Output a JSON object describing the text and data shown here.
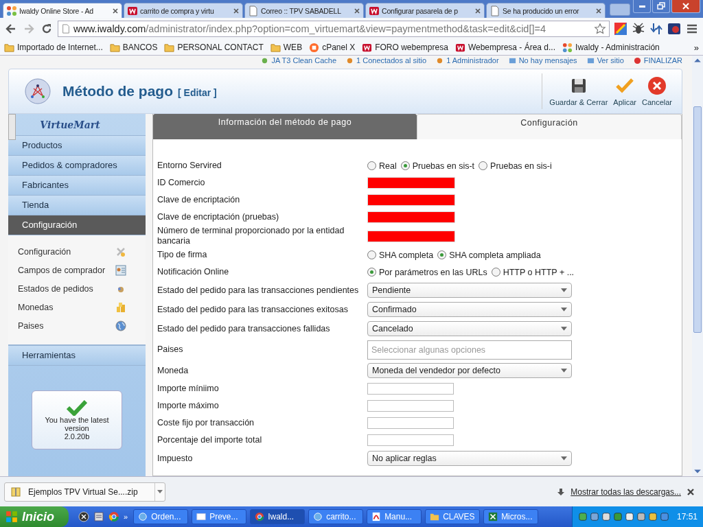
{
  "browser_tabs": [
    {
      "title": "Iwaldy Online Store - Ad",
      "kind": "joomla",
      "selected": true
    },
    {
      "title": "carrito de compra y virtu",
      "kind": "webempresa",
      "selected": false
    },
    {
      "title": "Correo :: TPV SABADELL",
      "kind": "page",
      "selected": false
    },
    {
      "title": "Configurar pasarela de p",
      "kind": "webempresa",
      "selected": false
    },
    {
      "title": "Se ha producido un error",
      "kind": "page",
      "selected": false
    }
  ],
  "address": {
    "host": "www.iwaldy.com",
    "path": "/administrator/index.php?option=com_virtuemart&view=paymentmethod&task=edit&cid[]=4"
  },
  "bookmarks": [
    {
      "label": "Importado de Internet...",
      "kind": "folder"
    },
    {
      "label": "BANCOS",
      "kind": "folder"
    },
    {
      "label": "PERSONAL CONTACT",
      "kind": "folder"
    },
    {
      "label": "WEB",
      "kind": "folder"
    },
    {
      "label": "cPanel X",
      "kind": "cpanel"
    },
    {
      "label": "FORO webempresa",
      "kind": "webempresa"
    },
    {
      "label": "Webempresa - Área d...",
      "kind": "webempresa"
    },
    {
      "label": "Iwaldy - Administración",
      "kind": "joomla"
    }
  ],
  "bookmarks_more": "»",
  "admin_links": [
    {
      "label": "JA T3 Clean Cache",
      "kind": "cache"
    },
    {
      "label": "1 Conectados al sitio",
      "kind": "users"
    },
    {
      "label": "1 Administrador",
      "kind": "users"
    },
    {
      "label": "No hay mensajes",
      "kind": "mail"
    },
    {
      "label": "Ver sitio",
      "kind": "screen"
    },
    {
      "label": "FINALIZAR",
      "kind": "logout"
    }
  ],
  "header": {
    "title": "Método de pago",
    "subtitle": "[ Editar ]",
    "actions": [
      {
        "label": "Guardar & Cerrar",
        "kind": "save"
      },
      {
        "label": "Aplicar",
        "kind": "apply"
      },
      {
        "label": "Cancelar",
        "kind": "cancel"
      }
    ]
  },
  "sidebar": {
    "logo": "VirtueMart",
    "menu": [
      {
        "label": "Productos",
        "selected": false
      },
      {
        "label": "Pedidos & compradores",
        "selected": false
      },
      {
        "label": "Fabricantes",
        "selected": false
      },
      {
        "label": "Tienda",
        "selected": false
      },
      {
        "label": "Configuración",
        "selected": true
      }
    ],
    "submenu": [
      {
        "label": "Configuración",
        "kind": "tools"
      },
      {
        "label": "Campos de comprador",
        "kind": "form"
      },
      {
        "label": "Estados de pedidos",
        "kind": "status"
      },
      {
        "label": "Monedas",
        "kind": "coins"
      },
      {
        "label": "Paises",
        "kind": "globe"
      }
    ],
    "tools": "Herramientas",
    "version": [
      "You have the latest version",
      "2.0.20b"
    ]
  },
  "content_tabs": [
    {
      "label": "Información del método de pago",
      "selected": false
    },
    {
      "label": "Configuración",
      "selected": true
    }
  ],
  "fields": [
    {
      "label": "Entorno Servired",
      "kind": "radio",
      "options": [
        {
          "label": "Real",
          "selected": false
        },
        {
          "label": "Pruebas en sis-t",
          "selected": true
        },
        {
          "label": "Pruebas en sis-i",
          "selected": false
        }
      ]
    },
    {
      "label": "ID Comercio",
      "kind": "redacted"
    },
    {
      "label": "Clave de encriptación",
      "kind": "redacted"
    },
    {
      "label": "Clave de encriptación (pruebas)",
      "kind": "redacted"
    },
    {
      "label": "Número de terminal proporcionado por la entidad bancaria",
      "kind": "redacted"
    },
    {
      "label": "Tipo de firma",
      "kind": "radio",
      "options": [
        {
          "label": "SHA completa",
          "selected": false
        },
        {
          "label": "SHA completa ampliada",
          "selected": true
        }
      ]
    },
    {
      "label": "Notificación Online",
      "kind": "radio",
      "options": [
        {
          "label": "Por parámetros en las URLs",
          "selected": true
        },
        {
          "label": "HTTP o HTTP + ...",
          "selected": false
        }
      ]
    },
    {
      "label": "Estado del pedido para las transacciones pendientes",
      "kind": "select",
      "value": "Pendiente"
    },
    {
      "label": "Estado del pedido para las transacciones exitosas",
      "kind": "select",
      "value": "Confirmado"
    },
    {
      "label": "Estado del pedido para transacciones fallidas",
      "kind": "select",
      "value": "Cancelado"
    },
    {
      "label": "Paises",
      "kind": "multiselect",
      "placeholder": "Seleccionar algunas opciones"
    },
    {
      "label": "Moneda",
      "kind": "select",
      "value": "Moneda del vendedor por defecto"
    },
    {
      "label": "Importe míniimo",
      "kind": "input"
    },
    {
      "label": "Importe máximo",
      "kind": "input"
    },
    {
      "label": "Coste fijo por transacción",
      "kind": "input"
    },
    {
      "label": "Porcentaje del importe total",
      "kind": "input"
    },
    {
      "label": "Impuesto",
      "kind": "select",
      "value": "No aplicar reglas"
    }
  ],
  "downloads": {
    "file": "Ejemplos TPV Virtual Se....zip",
    "show_all": "Mostrar todas las descargas..."
  },
  "taskbar": {
    "start": "Inicio",
    "quick_more": "»",
    "items": [
      {
        "label": "Orden...",
        "kind": "app",
        "selected": false
      },
      {
        "label": "Preve...",
        "kind": "window",
        "selected": false
      },
      {
        "label": "Iwald...",
        "kind": "chrome",
        "selected": true
      },
      {
        "label": "carrito...",
        "kind": "app",
        "selected": false
      },
      {
        "label": "Manu...",
        "kind": "pdf",
        "selected": false
      },
      {
        "label": "CLAVES",
        "kind": "folder",
        "selected": false
      },
      {
        "label": "Micros...",
        "kind": "excel",
        "selected": false
      }
    ],
    "clock": "17:51"
  }
}
